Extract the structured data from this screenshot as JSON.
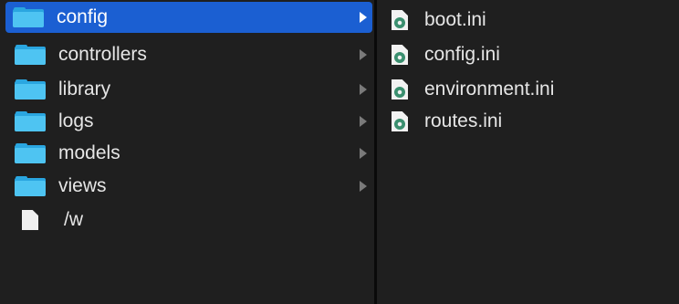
{
  "left_column": {
    "items": [
      {
        "label": "config",
        "icon": "folder-icon",
        "selected": true,
        "has_children": true
      },
      {
        "label": "controllers",
        "icon": "folder-icon",
        "selected": false,
        "has_children": true
      },
      {
        "label": "library",
        "icon": "folder-icon",
        "selected": false,
        "has_children": true
      },
      {
        "label": "logs",
        "icon": "folder-icon",
        "selected": false,
        "has_children": true
      },
      {
        "label": "models",
        "icon": "folder-icon",
        "selected": false,
        "has_children": true
      },
      {
        "label": "views",
        "icon": "folder-icon",
        "selected": false,
        "has_children": true
      },
      {
        "label": "/w",
        "icon": "document-icon",
        "selected": false,
        "has_children": false
      }
    ]
  },
  "right_column": {
    "items": [
      {
        "label": "boot.ini",
        "icon": "ini-file-icon"
      },
      {
        "label": "config.ini",
        "icon": "ini-file-icon"
      },
      {
        "label": "environment.ini",
        "icon": "ini-file-icon"
      },
      {
        "label": "routes.ini",
        "icon": "ini-file-icon"
      }
    ]
  },
  "colors": {
    "selection": "#1b5fd2",
    "folder": "#4ec4f2",
    "background": "#1f1f1f"
  }
}
